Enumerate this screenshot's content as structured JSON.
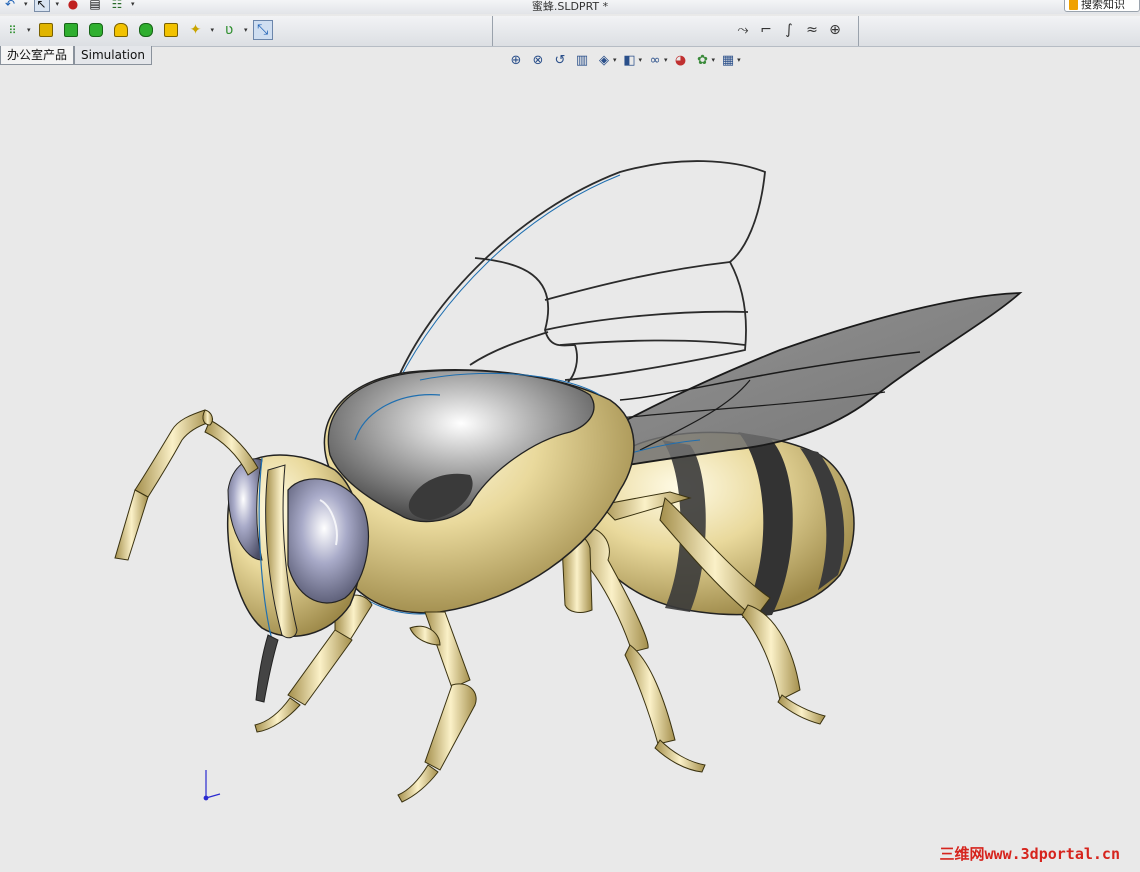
{
  "window": {
    "doc_title": "蜜蜂.SLDPRT *",
    "search_label": "搜索知识"
  },
  "tabs": [
    {
      "label": "办公室产品"
    },
    {
      "label": "Simulation"
    }
  ],
  "icons": {
    "top": [
      "undo-icon",
      "select-arrow-icon",
      "traffic-light-icon",
      "clipboard-icon",
      "options-icon"
    ],
    "features": [
      "linear-pattern-icon",
      "extrude-boss-icon",
      "extrude-cut-icon",
      "fillet-icon",
      "shell-icon",
      "mirror-icon",
      "instant3d-icon",
      "sketch-wand-icon",
      "curve-icon",
      "view-manager-icon"
    ],
    "surface": [
      "sweep-surface-icon",
      "extrude-surface-icon",
      "loft-surface-icon",
      "knit-surface-icon",
      "fill-surface-icon"
    ],
    "view": [
      "zoom-to-fit-icon",
      "zoom-area-icon",
      "previous-view-icon",
      "section-view-icon",
      "view-orientation-icon",
      "display-style-icon",
      "hide-show-icon",
      "appearance-icon",
      "scene-icon",
      "view-settings-icon"
    ]
  },
  "watermark": "三维网www.3dportal.cn",
  "colors": {
    "background": "#e9e9e9",
    "body_gold": "#e8d79c",
    "stripe_dark": "#3b3b3b",
    "edge_blue": "#1f6fb0",
    "watermark": "#d6241d"
  }
}
